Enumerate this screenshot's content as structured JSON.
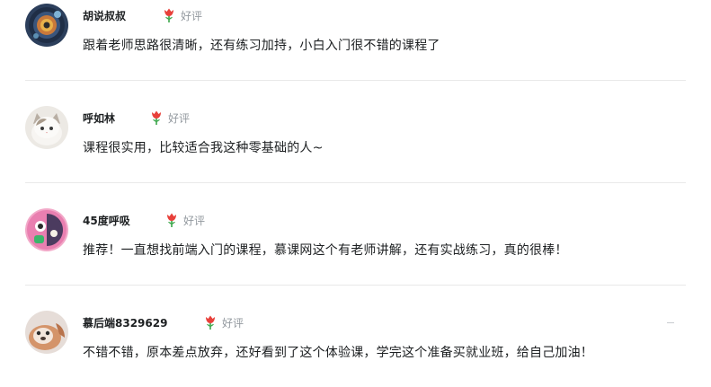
{
  "reviews": [
    {
      "name": "胡说叔叔",
      "rating_label": "好评",
      "content": "跟着老师思路很清晰，还有练习加持，小白入门很不错的课程了"
    },
    {
      "name": "呼如林",
      "rating_label": "好评",
      "content": "课程很实用，比较适合我这种零基础的人~"
    },
    {
      "name": "45度呼吸",
      "rating_label": "好评",
      "content": "推荐！一直想找前端入门的课程，慕课网这个有老师讲解，还有实战练习，真的很棒！"
    },
    {
      "name": "慕后端8329629",
      "rating_label": "好评",
      "content": "不错不错，原本差点放弃，还好看到了这个体验课，学完这个准备买就业班，给自己加油！"
    }
  ],
  "icons": {
    "rating": "flower-icon"
  },
  "colors": {
    "name": "#1c1f21",
    "content": "#1c1f21",
    "rating_text": "#93999f",
    "flower_red": "#e8403a",
    "flower_green": "#3aa64a",
    "divider": "#e9e9e9"
  }
}
